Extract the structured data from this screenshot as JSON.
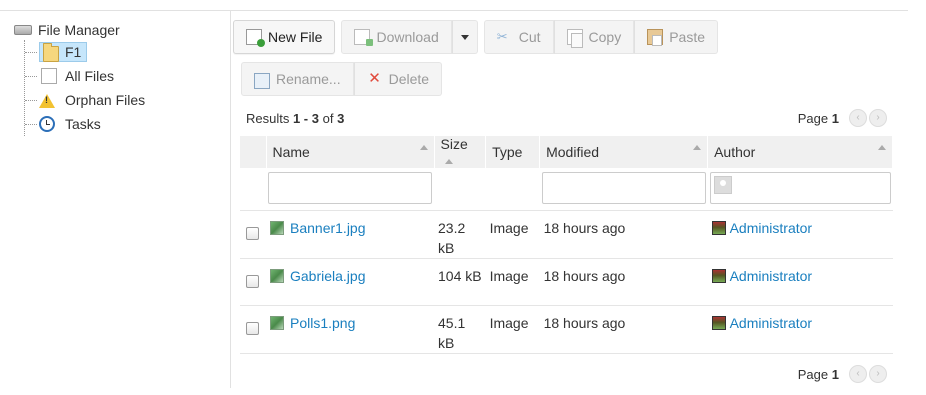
{
  "tree": {
    "root_label": "File Manager",
    "items": [
      {
        "label": "F1",
        "selected": true,
        "icon": "folder-icon"
      },
      {
        "label": "All Files",
        "icon": "documents-icon"
      },
      {
        "label": "Orphan Files",
        "icon": "warning-icon"
      },
      {
        "label": "Tasks",
        "icon": "clock-icon"
      }
    ]
  },
  "toolbar": {
    "new_file": "New File",
    "download": "Download",
    "cut": "Cut",
    "copy": "Copy",
    "paste": "Paste",
    "rename": "Rename...",
    "delete": "Delete"
  },
  "results": {
    "prefix": "Results ",
    "range": "1 - 3",
    "of_text": " of ",
    "total": "3",
    "page_label": "Page ",
    "page": "1"
  },
  "table": {
    "columns": [
      "Name",
      "Size",
      "Type",
      "Modified",
      "Author"
    ],
    "rows": [
      {
        "name": "Banner1.jpg",
        "size": "23.2 kB",
        "type": "Image",
        "modified": "18 hours ago",
        "author": "Administrator"
      },
      {
        "name": "Gabriela.jpg",
        "size": "104 kB",
        "type": "Image",
        "modified": "18 hours ago",
        "author": "Administrator"
      },
      {
        "name": "Polls1.png",
        "size": "45.1 kB",
        "type": "Image",
        "modified": "18 hours ago",
        "author": "Administrator"
      }
    ]
  },
  "colors": {
    "link": "#1a7fbf",
    "selected_bg": "#c6e6fb",
    "delete_icon": "#e14a3c"
  }
}
